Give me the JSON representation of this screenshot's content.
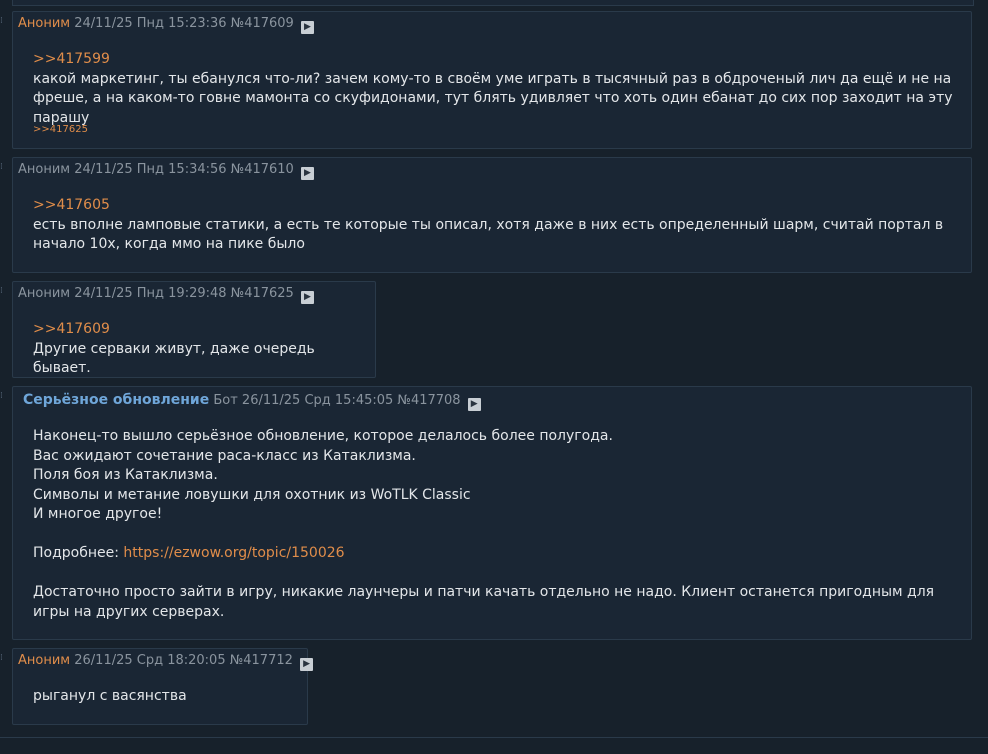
{
  "posts": [
    {
      "name": "Аноним",
      "meta": "24/11/25 Пнд 15:23:36 №417609",
      "reply_to": ">>417599",
      "body": "какой маркетинг, ты ебанулся что-ли? зачем кому-то в своём уме играть в тысячный раз в обдроченый лич да ещё и не на фреше, а на каком-то говне мамонта со скуфидонами, тут блять удивляет что хоть один ебанат до сих пор заходит на эту парашу",
      "backlink": ">>417625"
    },
    {
      "name": "Аноним",
      "meta": "24/11/25 Пнд 15:34:56 №417610",
      "reply_to": ">>417605",
      "body": "есть вполне ламповые статики, а есть те которые ты описал, хотя даже в них есть определенный шарм, считай портал в начало 10х, когда ммо на пике было"
    },
    {
      "name": "Аноним",
      "meta": "24/11/25 Пнд 19:29:48 №417625",
      "reply_to": ">>417609",
      "body": "Другие серваки живут, даже очередь бывает."
    },
    {
      "name": "Серьёзное обновление",
      "meta": "Бот 26/11/25 Срд 15:45:05 №417708",
      "body_lines": [
        "Наконец-то вышло серьёзное обновление, которое делалось более полугода.",
        "Вас ожидают сочетание раса-класс из Катаклизма.",
        "Поля боя из Катаклизма.",
        "Символы и метание ловушки для охотник из WoTLK Classic",
        "И многое другое!"
      ],
      "more_label": "Подробнее: ",
      "more_url": "https://ezwow.org/topic/150026",
      "footer": "Достаточно просто зайти в игру, никакие лаунчеры и патчи качать отдельно не надо. Клиент останется пригодным для игры на других серверах."
    },
    {
      "name": "Аноним",
      "meta": "26/11/25 Срд 18:20:05 №417712",
      "body": "рыганул с васянства"
    }
  ],
  "icons": {
    "play": "play-icon"
  },
  "colors": {
    "bg": "#17212b",
    "post_bg": "#1a2634",
    "link": "#e08d4a",
    "name_bold": "#6fa6d9"
  }
}
